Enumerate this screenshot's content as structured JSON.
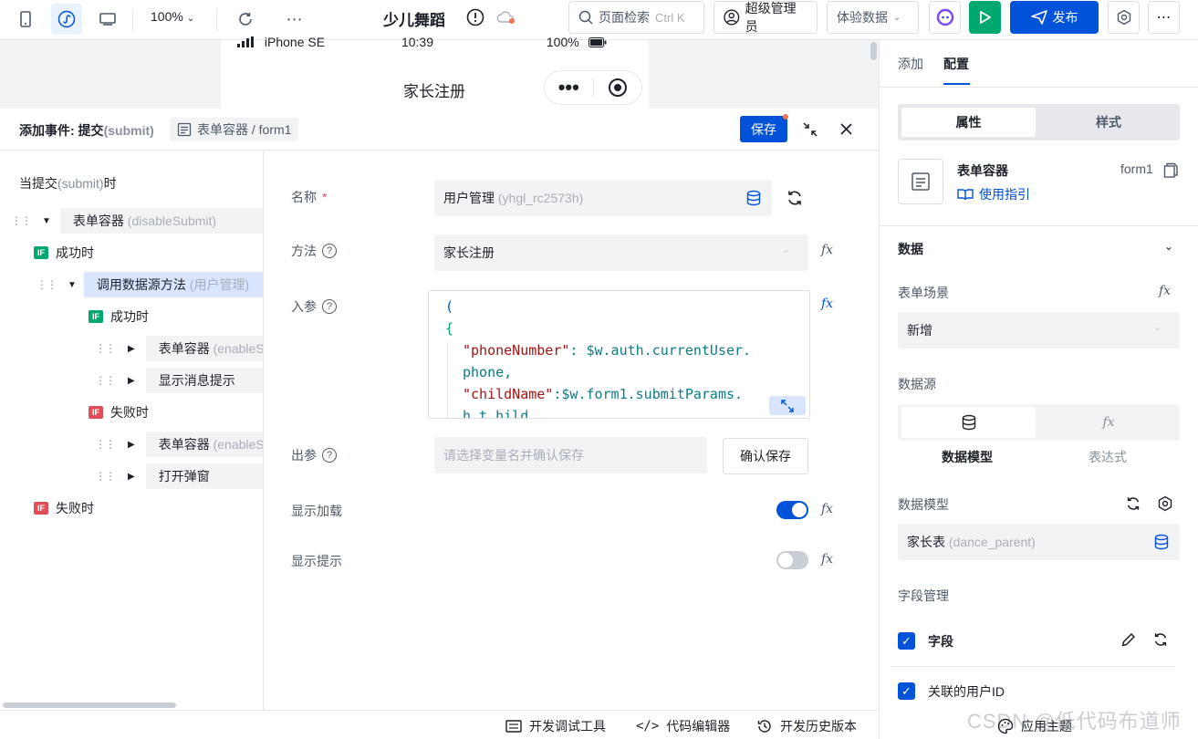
{
  "topbar": {
    "zoom": "100%",
    "app_title": "少儿舞蹈",
    "search_label": "页面检索",
    "search_shortcut": "Ctrl K",
    "user_role": "超级管理员",
    "env_select": "体验数据",
    "publish_label": "发布"
  },
  "phone": {
    "device": "iPhone SE",
    "time": "10:39",
    "battery": "100%",
    "page_title": "家长注册"
  },
  "event": {
    "title_prefix": "添加事件: 提交",
    "title_event": "(submit)",
    "breadcrumb": "表单容器 / form1",
    "save_label": "保存",
    "save_color": "#0052d9"
  },
  "tree": {
    "root_label": "当提交",
    "root_event": "(submit)",
    "root_suffix": "时",
    "nodes": [
      {
        "label": "表单容器",
        "hint": "(disableSubmit)"
      },
      {
        "label": "成功时",
        "badge": "IF"
      },
      {
        "label": "调用数据源方法",
        "hint": "(用户管理)"
      },
      {
        "label": "成功时",
        "badge": "IF"
      },
      {
        "label": "表单容器",
        "hint": "(enableSul"
      },
      {
        "label": "显示消息提示",
        "hint": ""
      },
      {
        "label": "失败时",
        "badge": "IF"
      },
      {
        "label": "表单容器",
        "hint": "(enableSul"
      },
      {
        "label": "打开弹窗",
        "hint": ""
      },
      {
        "label": "失败时",
        "badge": "IF"
      }
    ]
  },
  "form": {
    "name_label": "名称",
    "name_required": "*",
    "name_value": "用户管理",
    "name_hint": "(yhgl_rc2573h)",
    "method_label": "方法",
    "method_value": "家长注册",
    "params_label": "入参",
    "code_lines": [
      "(",
      "{",
      "\"phoneNumber\"",
      ": $w.auth.currentUser.",
      "phone,",
      "\"childName\"",
      ":$w.form1.submitParams.",
      "h  t    hild"
    ],
    "output_label": "出参",
    "output_placeholder": "请选择变量名并确认保存",
    "confirm_save": "确认保存",
    "show_loading_label": "显示加载",
    "show_loading": true,
    "show_tip_label": "显示提示",
    "show_tip": false,
    "fx": "fx"
  },
  "bottombar": {
    "dev_tools": "开发调试工具",
    "code_editor": "代码编辑器",
    "history": "开发历史版本",
    "theme": "应用主题"
  },
  "right": {
    "tab_add": "添加",
    "tab_config": "配置",
    "seg_props": "属性",
    "seg_style": "样式",
    "comp_name": "表单容器",
    "comp_id": "form1",
    "guide": "使用指引",
    "section_data": "数据",
    "scene_label": "表单场景",
    "scene_value": "新增",
    "source_label": "数据源",
    "source_model": "数据模型",
    "source_expr": "表达式",
    "model_label": "数据模型",
    "model_value": "家长表",
    "model_hint": "(dance_parent)",
    "field_mgmt": "字段管理",
    "field_label": "字段",
    "related_user": "关联的用户ID"
  },
  "watermark": "CSDN @低代码布道师"
}
